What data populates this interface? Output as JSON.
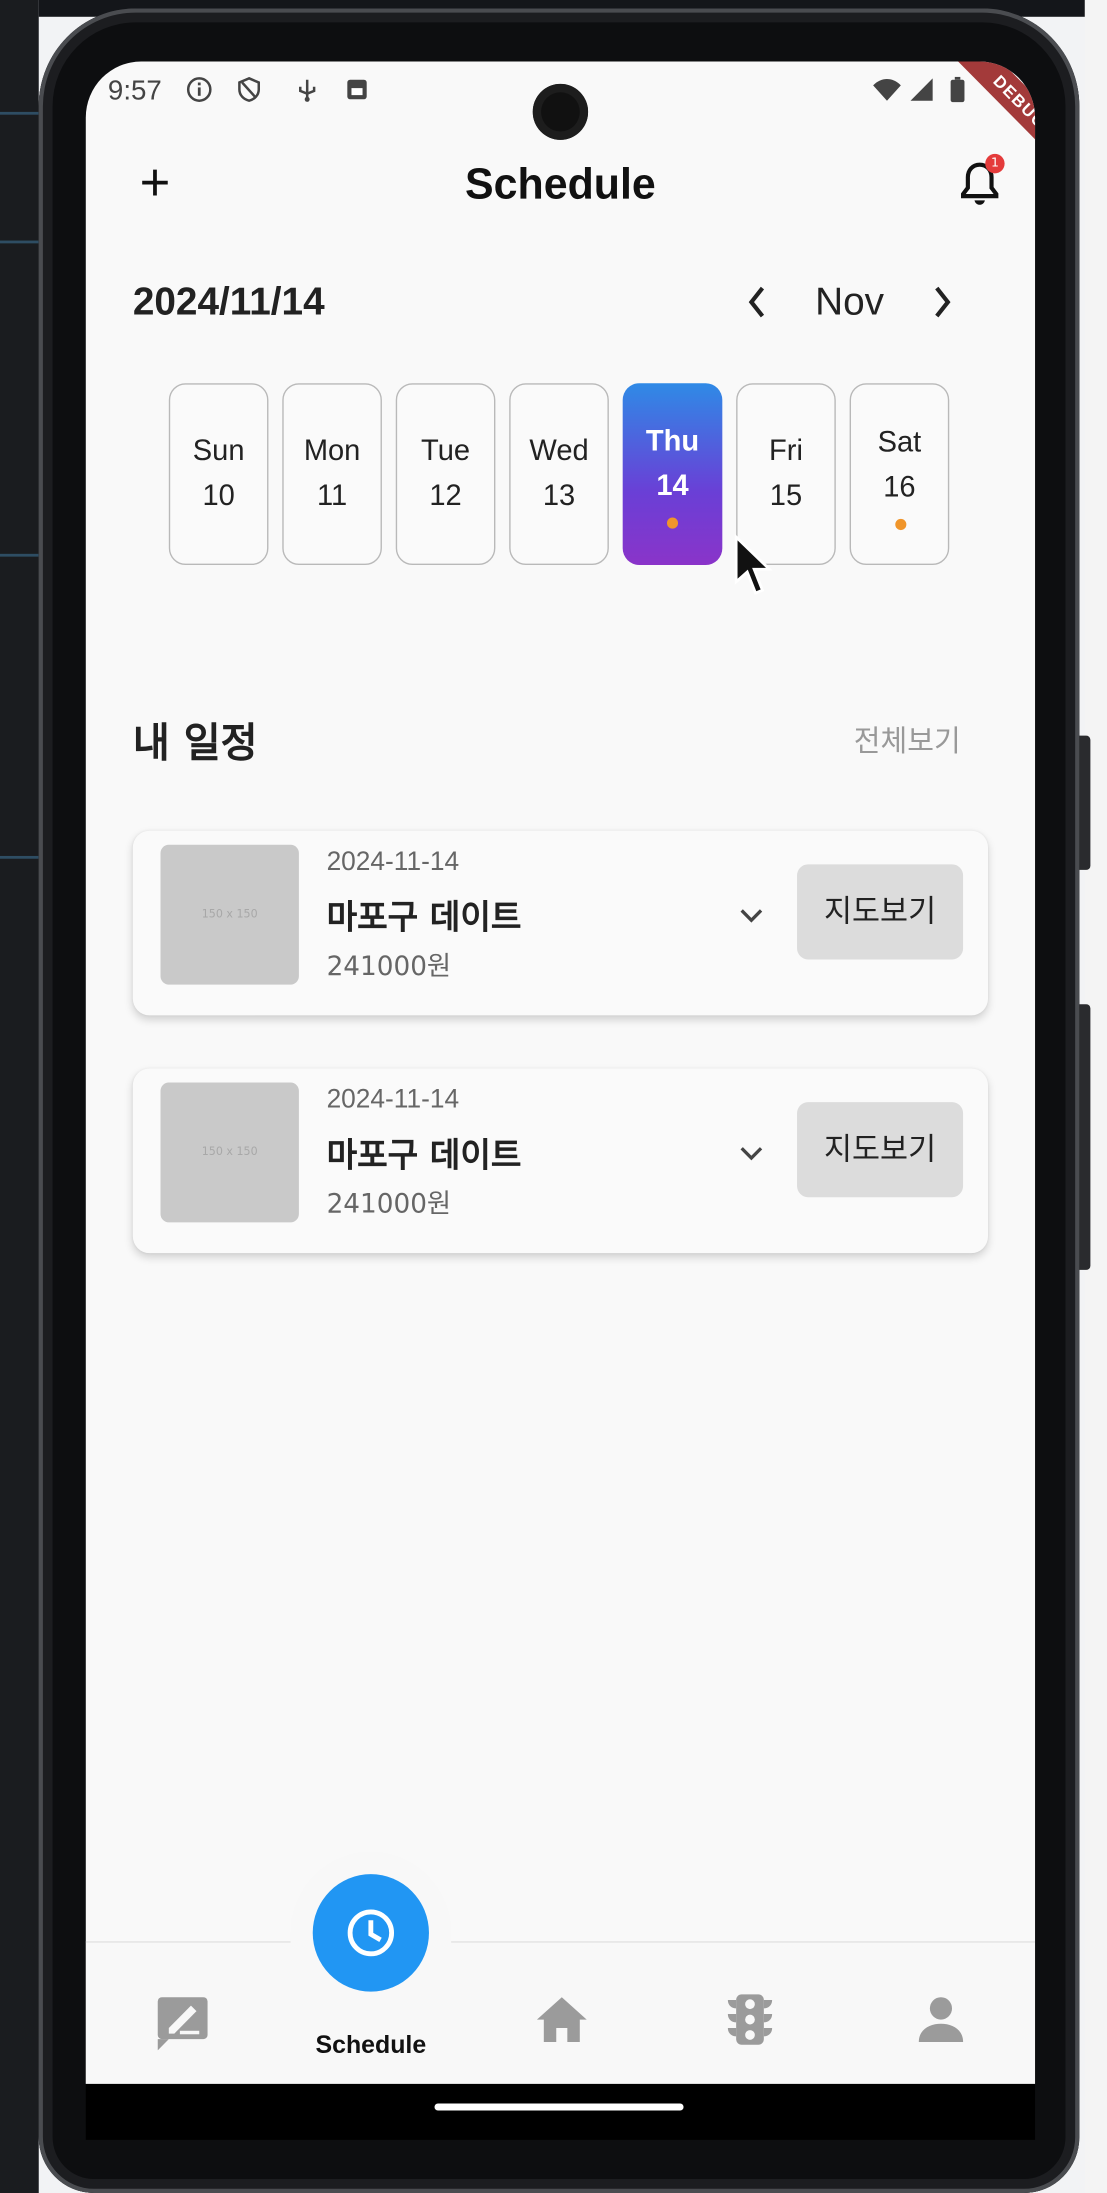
{
  "status_bar": {
    "time": "9:57",
    "icons": [
      "info-icon",
      "shield-icon",
      "usb-icon",
      "storage-icon",
      "wifi-icon",
      "signal-icon",
      "battery-icon"
    ],
    "debug_banner": "DEBUG"
  },
  "app_bar": {
    "title": "Schedule",
    "add_label": "+",
    "notification_badge": "1"
  },
  "date_header": {
    "selected_date": "2024/11/14",
    "month": "Nov",
    "prev_label": "‹",
    "next_label": "›"
  },
  "week": [
    {
      "day": "Sun",
      "date": "10",
      "selected": false,
      "has_event": false
    },
    {
      "day": "Mon",
      "date": "11",
      "selected": false,
      "has_event": false
    },
    {
      "day": "Tue",
      "date": "12",
      "selected": false,
      "has_event": false
    },
    {
      "day": "Wed",
      "date": "13",
      "selected": false,
      "has_event": false
    },
    {
      "day": "Thu",
      "date": "14",
      "selected": true,
      "has_event": true
    },
    {
      "day": "Fri",
      "date": "15",
      "selected": false,
      "has_event": false
    },
    {
      "day": "Sat",
      "date": "16",
      "selected": false,
      "has_event": true
    }
  ],
  "my_schedule": {
    "title": "내 일정",
    "view_all": "전체보기",
    "items": [
      {
        "thumb_label": "150 x 150",
        "date": "2024-11-14",
        "title": "마포구 데이트",
        "price": "241000원",
        "map_button": "지도보기"
      },
      {
        "thumb_label": "150 x 150",
        "date": "2024-11-14",
        "title": "마포구 데이트",
        "price": "241000원",
        "map_button": "지도보기"
      }
    ]
  },
  "bottom_nav": {
    "active_label": "Schedule",
    "items": [
      "edit-icon",
      "schedule-icon",
      "home-icon",
      "traffic-light-icon",
      "person-icon"
    ]
  },
  "colors": {
    "accent": "#2196f3",
    "selected_gradient_top": "#2f8ae6",
    "selected_gradient_bottom": "#8a34c9",
    "event_dot": "#f0952a",
    "badge": "#e43b3b"
  }
}
